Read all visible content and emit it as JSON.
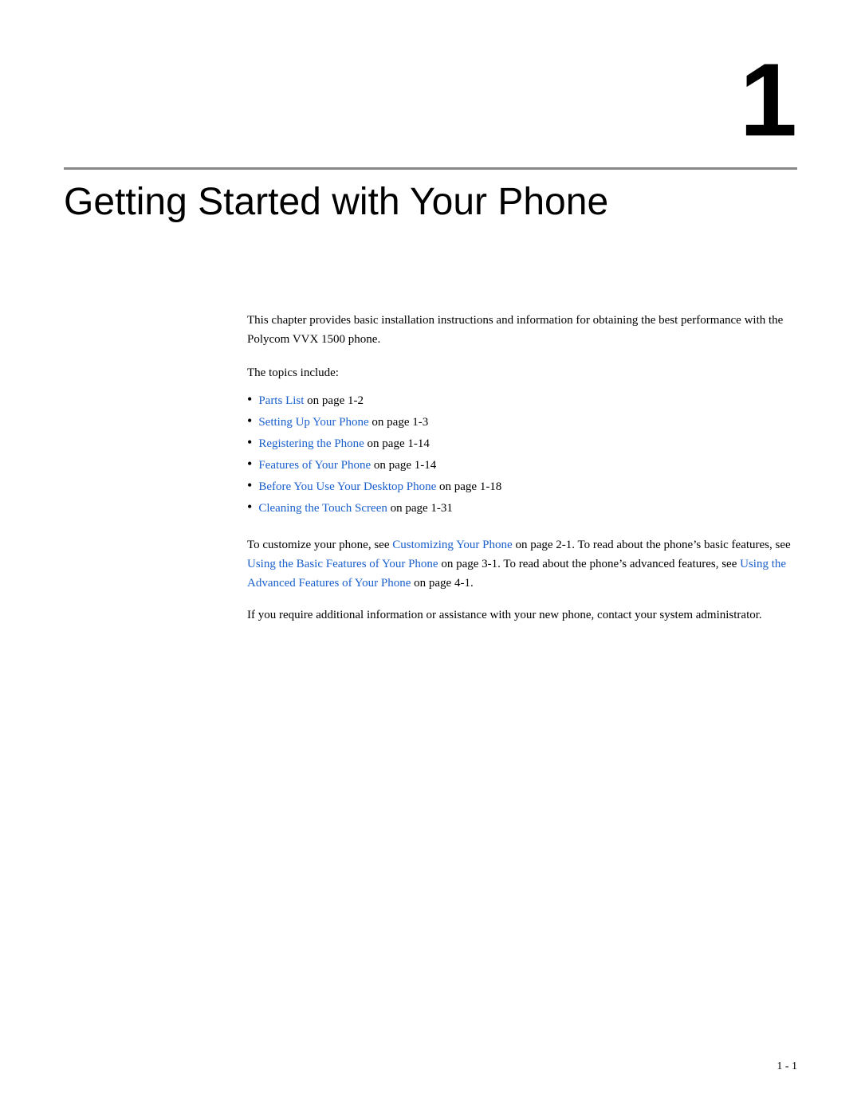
{
  "chapter": {
    "number": "1",
    "title": "Getting Started with Your Phone"
  },
  "intro": {
    "paragraph1": "This chapter provides basic installation instructions and information for obtaining the best performance with the Polycom VVX 1500 phone.",
    "topics_label": "The topics include:"
  },
  "topics": [
    {
      "link_text": "Parts List",
      "link_href": "#",
      "plain_text": " on page 1-2"
    },
    {
      "link_text": "Setting Up Your Phone",
      "link_href": "#",
      "plain_text": " on page 1-3"
    },
    {
      "link_text": "Registering the Phone",
      "link_href": "#",
      "plain_text": " on page 1-14"
    },
    {
      "link_text": "Features of Your Phone",
      "link_href": "#",
      "plain_text": " on page 1-14"
    },
    {
      "link_text": "Before You Use Your Desktop Phone",
      "link_href": "#",
      "plain_text": " on page 1-18"
    },
    {
      "link_text": "Cleaning the Touch Screen",
      "link_href": "#",
      "plain_text": " on page 1-31"
    }
  ],
  "body_paragraphs": [
    {
      "id": "para1",
      "parts": [
        {
          "type": "plain",
          "text": "To customize your phone, see "
        },
        {
          "type": "link",
          "text": "Customizing Your Phone"
        },
        {
          "type": "plain",
          "text": " on page 2-1. To read about the phone’s basic features, see "
        },
        {
          "type": "link",
          "text": "Using the Basic Features of Your Phone"
        },
        {
          "type": "plain",
          "text": " on page 3-1. To read about the phone’s advanced features, see "
        },
        {
          "type": "link",
          "text": "Using the Advanced Features of Your Phone"
        },
        {
          "type": "plain",
          "text": " on page 4-1."
        }
      ]
    },
    {
      "id": "para2",
      "parts": [
        {
          "type": "plain",
          "text": "If you require additional information or assistance with your new phone, contact your system administrator."
        }
      ]
    }
  ],
  "footer": {
    "page_number": "1 - 1"
  }
}
